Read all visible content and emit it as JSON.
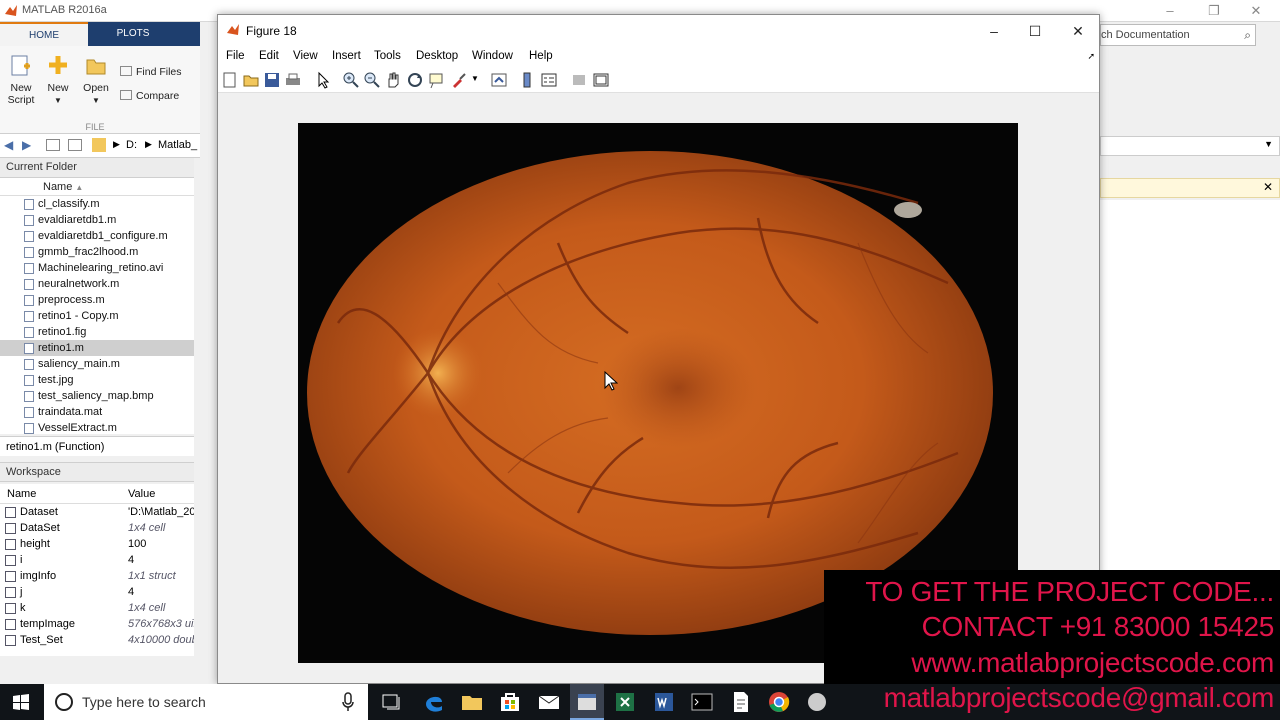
{
  "app": {
    "title": "MATLAB R2016a"
  },
  "ribbon": {
    "tabs": [
      "HOME",
      "PLOTS"
    ],
    "new_script": "New\nScript",
    "new_script_l1": "New",
    "new_script_l2": "Script",
    "new": "New",
    "open": "Open",
    "find_files": "Find Files",
    "compare": "Compare",
    "group_file": "FILE"
  },
  "address": {
    "drive": "D:",
    "folder": "Matlab_"
  },
  "current_folder": {
    "header": "Current Folder",
    "column_name": "Name",
    "files": [
      {
        "name": "cl_classify.m"
      },
      {
        "name": "evaldiaretdb1.m"
      },
      {
        "name": "evaldiaretdb1_configure.m"
      },
      {
        "name": "gmmb_frac2lhood.m"
      },
      {
        "name": "Machinelearing_retino.avi"
      },
      {
        "name": "neuralnetwork.m"
      },
      {
        "name": "preprocess.m"
      },
      {
        "name": "retino1 - Copy.m"
      },
      {
        "name": "retino1.fig"
      },
      {
        "name": "retino1.m"
      },
      {
        "name": "saliency_main.m"
      },
      {
        "name": "test.jpg"
      },
      {
        "name": "test_saliency_map.bmp"
      },
      {
        "name": "traindata.mat"
      },
      {
        "name": "VesselExtract.m"
      }
    ],
    "selected": "retino1.m",
    "details": "retino1.m  (Function)"
  },
  "workspace": {
    "header": "Workspace",
    "col_name": "Name",
    "col_value": "Value",
    "vars": [
      {
        "name": "Dataset",
        "value": "'D:\\Matlab_20"
      },
      {
        "name": "DataSet",
        "value": "1x4 cell"
      },
      {
        "name": "height",
        "value": "100"
      },
      {
        "name": "i",
        "value": "4"
      },
      {
        "name": "imgInfo",
        "value": "1x1 struct"
      },
      {
        "name": "j",
        "value": "4"
      },
      {
        "name": "k",
        "value": "1x4 cell"
      },
      {
        "name": "tempImage",
        "value": "576x768x3 uin"
      },
      {
        "name": "Test_Set",
        "value": "4x10000 doub"
      }
    ]
  },
  "right": {
    "search_placeholder": "ch Documentation"
  },
  "figure": {
    "title": "Figure 18",
    "menu": [
      "File",
      "Edit",
      "View",
      "Insert",
      "Tools",
      "Desktop",
      "Window",
      "Help"
    ]
  },
  "taskbar": {
    "search": "Type here to search"
  },
  "promo": {
    "line1": "TO GET THE PROJECT CODE...",
    "line2": "CONTACT +91 83000 15425",
    "line3": "www.matlabprojectscode.com",
    "line4": "matlabprojectscode@gmail.com"
  },
  "colors": {
    "promo_text": "#e0154a",
    "ribbon_tab_bg": "#1e3e6e",
    "retina_orange": "#c85a1c"
  }
}
